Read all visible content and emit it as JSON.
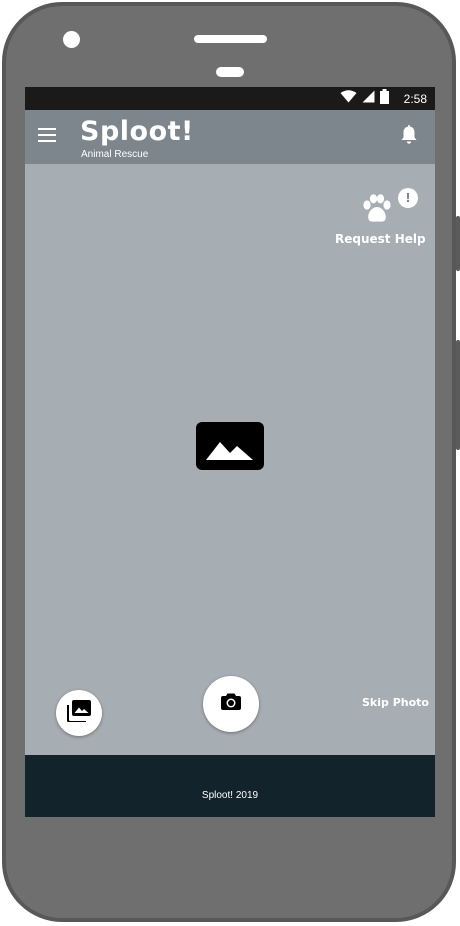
{
  "status_bar": {
    "time": "2:58",
    "icons": [
      "wifi-icon",
      "signal-icon",
      "battery-icon"
    ]
  },
  "app_bar": {
    "title": "Sploot!",
    "subtitle": "Animal Rescue",
    "menu_icon": "hamburger-menu-icon",
    "notification_icon": "bell-icon"
  },
  "request_help": {
    "label": "Request Help",
    "icon": "paw-icon",
    "badge": "!"
  },
  "photo": {
    "placeholder_icon": "image-placeholder-icon"
  },
  "actions": {
    "gallery_icon": "photo-library-icon",
    "camera_icon": "camera-icon",
    "skip_label": "Skip Photo"
  },
  "footer": {
    "text": "Sploot! 2019"
  },
  "colors": {
    "app_bar": "#7d858d",
    "content_bg": "#a6adb3",
    "footer_bg": "#12232b",
    "status_bar": "#1a1a1a",
    "device_body": "#6f6f6f"
  }
}
